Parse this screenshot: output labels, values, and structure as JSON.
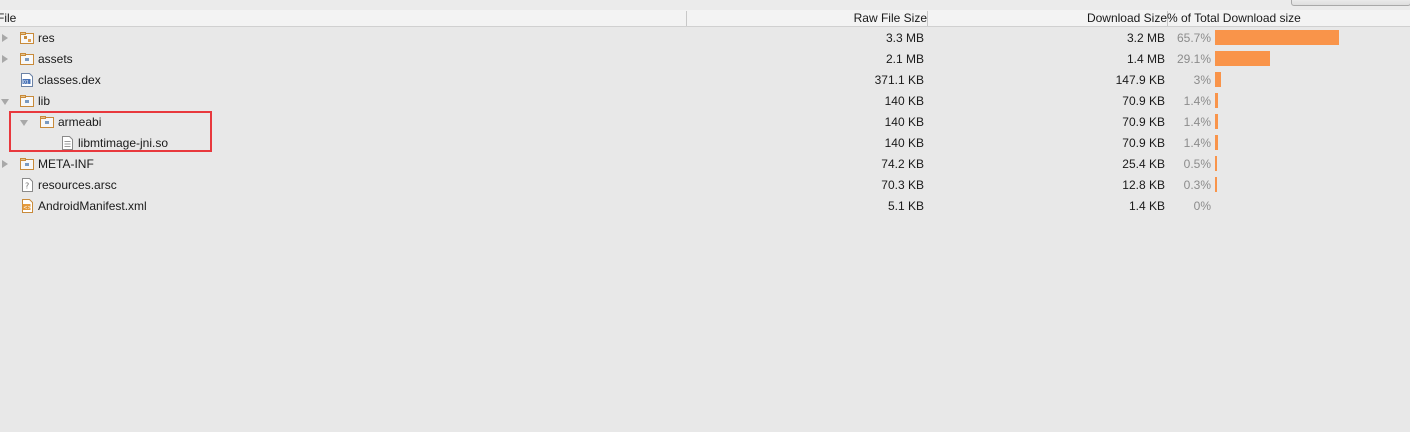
{
  "header": {
    "file": "File",
    "raw_size": "Raw File Size",
    "download_size": "Download Size",
    "percent_total": "% of Total Download size"
  },
  "colors": {
    "bar": "#f9944a",
    "highlight": "#e8383d"
  },
  "rows": [
    {
      "name": "res",
      "icon": "folder-res-icon",
      "expander": "collapsed",
      "raw": "3.3 MB",
      "download": "3.2 MB",
      "percent": "65.7%",
      "fraction": 0.657
    },
    {
      "name": "assets",
      "icon": "folder-icon",
      "expander": "collapsed",
      "raw": "2.1 MB",
      "download": "1.4 MB",
      "percent": "29.1%",
      "fraction": 0.291
    },
    {
      "name": "classes.dex",
      "icon": "dex-file-icon",
      "expander": "none",
      "raw": "371.1 KB",
      "download": "147.9 KB",
      "percent": "3%",
      "fraction": 0.03
    },
    {
      "name": "lib",
      "icon": "folder-icon",
      "expander": "expanded",
      "raw": "140 KB",
      "download": "70.9 KB",
      "percent": "1.4%",
      "fraction": 0.014
    },
    {
      "name": "armeabi",
      "icon": "folder-icon",
      "expander": "expanded",
      "raw": "140 KB",
      "download": "70.9 KB",
      "percent": "1.4%",
      "fraction": 0.014
    },
    {
      "name": "libmtimage-jni.so",
      "icon": "text-file-icon",
      "expander": "none",
      "raw": "140 KB",
      "download": "70.9 KB",
      "percent": "1.4%",
      "fraction": 0.014
    },
    {
      "name": "META-INF",
      "icon": "folder-icon",
      "expander": "collapsed",
      "raw": "74.2 KB",
      "download": "25.4 KB",
      "percent": "0.5%",
      "fraction": 0.005
    },
    {
      "name": "resources.arsc",
      "icon": "unknown-file-icon",
      "expander": "none",
      "raw": "70.3 KB",
      "download": "12.8 KB",
      "percent": "0.3%",
      "fraction": 0.003
    },
    {
      "name": "AndroidManifest.xml",
      "icon": "xml-file-icon",
      "expander": "none",
      "raw": "5.1 KB",
      "download": "1.4 KB",
      "percent": "0%",
      "fraction": 0
    }
  ]
}
